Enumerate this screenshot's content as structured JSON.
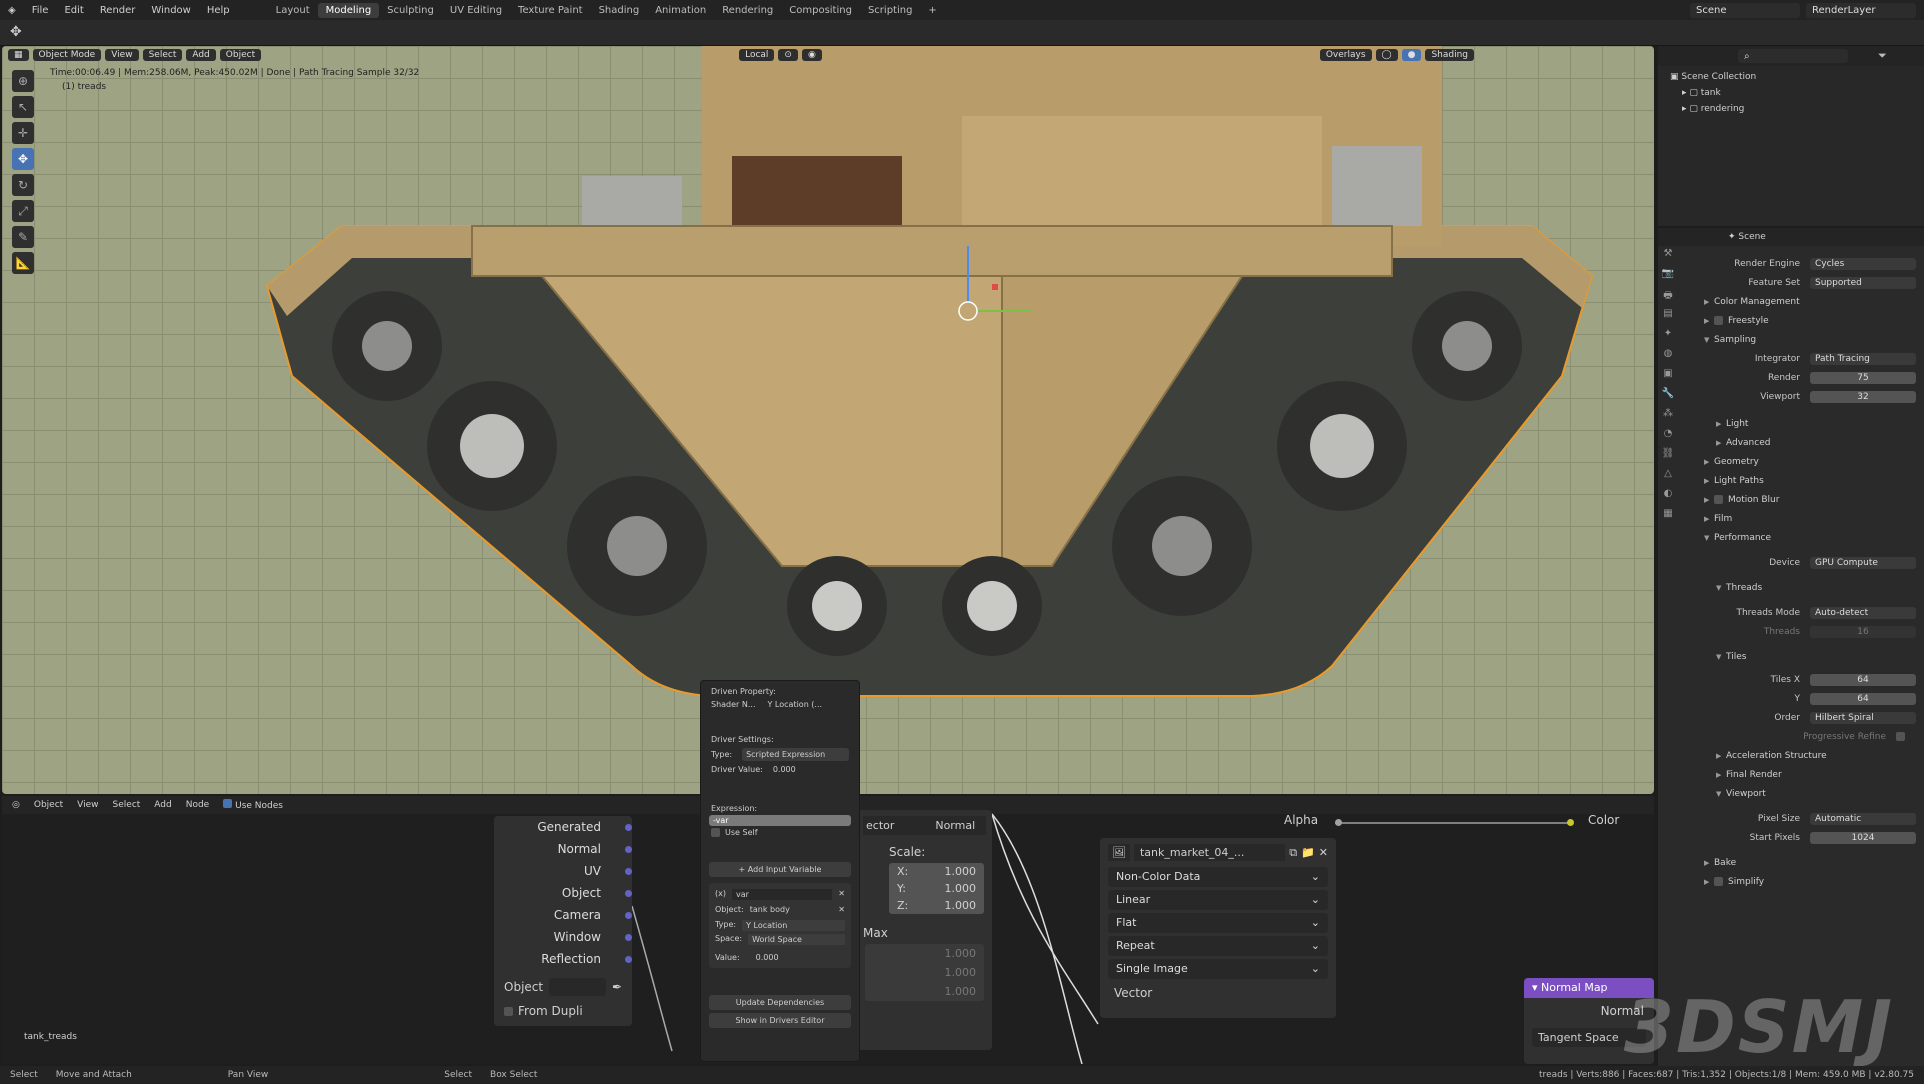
{
  "topbar": {
    "menus": [
      "File",
      "Edit",
      "Render",
      "Window",
      "Help"
    ],
    "workspaces": [
      "Layout",
      "Modeling",
      "Sculpting",
      "UV Editing",
      "Texture Paint",
      "Shading",
      "Animation",
      "Rendering",
      "Compositing",
      "Scripting"
    ],
    "active_workspace": "Modeling",
    "scene": "Scene",
    "view_layer": "RenderLayer"
  },
  "viewport": {
    "mode": "Object Mode",
    "menus": [
      "View",
      "Select",
      "Add",
      "Object"
    ],
    "orientation": "Local",
    "overlays_label": "Overlays",
    "shading_label": "Shading",
    "render_info": "Time:00:06.49 | Mem:258.06M, Peak:450.02M | Done | Path Tracing Sample 32/32",
    "object_info": "(1) treads"
  },
  "outliner": {
    "root": "Scene Collection",
    "items": [
      {
        "label": "tank"
      },
      {
        "label": "rendering"
      }
    ]
  },
  "properties": {
    "scene_label": "Scene",
    "render_engine_label": "Render Engine",
    "render_engine": "Cycles",
    "feature_set_label": "Feature Set",
    "feature_set": "Supported",
    "color_management": "Color Management",
    "freestyle": "Freestyle",
    "sampling": "Sampling",
    "integrator_label": "Integrator",
    "integrator": "Path Tracing",
    "render_label": "Render",
    "render_samples": "75",
    "viewport_label": "Viewport",
    "viewport_samples": "32",
    "light": "Light",
    "advanced": "Advanced",
    "geometry": "Geometry",
    "light_paths": "Light Paths",
    "motion_blur": "Motion Blur",
    "film": "Film",
    "performance": "Performance",
    "device_label": "Device",
    "device": "GPU Compute",
    "threads": "Threads",
    "threads_mode_label": "Threads Mode",
    "threads_mode": "Auto-detect",
    "threads_count_label": "Threads",
    "threads_count": "16",
    "tiles": "Tiles",
    "tiles_x_label": "Tiles X",
    "tiles_x": "64",
    "tiles_y_label": "Y",
    "tiles_y": "64",
    "order_label": "Order",
    "order": "Hilbert Spiral",
    "progressive_refine": "Progressive Refine",
    "acceleration_structure": "Acceleration Structure",
    "final_render": "Final Render",
    "viewport_section": "Viewport",
    "pixel_size_label": "Pixel Size",
    "pixel_size": "Automatic",
    "start_pixels_label": "Start Pixels",
    "start_pixels": "1024",
    "bake": "Bake",
    "simplify": "Simplify"
  },
  "node_editor": {
    "mode": "Object",
    "menus": [
      "View",
      "Select",
      "Add",
      "Node"
    ],
    "use_nodes": "Use Nodes",
    "texcoord_outputs": [
      "Generated",
      "Normal",
      "UV",
      "Object",
      "Camera",
      "Window",
      "Reflection"
    ],
    "object_label": "Object",
    "from_dupli": "From Dupli",
    "object_name": "tank_treads",
    "mapping_tabs": [
      "ector",
      "Normal"
    ],
    "scale_label": "Scale:",
    "scale": [
      {
        "axis": "X:",
        "value": "1.000"
      },
      {
        "axis": "Y:",
        "value": "1.000"
      },
      {
        "axis": "Z:",
        "value": "1.000"
      }
    ],
    "max_label": "Max",
    "max_values": [
      "1.000",
      "1.000",
      "1.000"
    ],
    "image_name": "tank_market_04_...",
    "image_options": [
      "Non-Color Data",
      "Linear",
      "Flat",
      "Repeat",
      "Single Image"
    ],
    "vector_label": "Vector",
    "alpha_label": "Alpha",
    "color_label": "Color",
    "normal_map_title": "Normal Map",
    "normal_map_output": "Normal",
    "tangent_space": "Tangent Space"
  },
  "driver": {
    "driven_property": "Driven Property:",
    "shader_n": "Shader N...",
    "y_location": "Y Location (...",
    "driver_settings": "Driver Settings:",
    "type_label": "Type:",
    "type_value": "Scripted Expression",
    "driver_value_label": "Driver Value:",
    "driver_value": "0.000",
    "expression_label": "Expression:",
    "expression": "-var",
    "use_self": "Use Self",
    "add_input_variable": "Add Input Variable",
    "var_name": "var",
    "object_label": "Object:",
    "object_value": "tank body",
    "var_type_label": "Type:",
    "var_type": "Y Location",
    "space_label": "Space:",
    "space": "World Space",
    "value_label": "Value:",
    "value": "0.000",
    "update_dependencies": "Update Dependencies",
    "show_in_drivers_editor": "Show in Drivers Editor"
  },
  "statusbar": {
    "items": [
      "Select",
      "Move and Attach",
      "Pan View",
      "Select",
      "Box Select"
    ],
    "stats": "treads | Verts:886 | Faces:687 | Tris:1,352 | Objects:1/8 | Mem: 459.0 MB | v2.80.75"
  },
  "watermark": "3DSMJ",
  "colors": {
    "accent": "#4772b3",
    "viewport_bg": "#9ea383",
    "selected_outline": "#e89a2c",
    "node_purple": "#6363c7",
    "normal_map_header": "#7b4fc2"
  }
}
